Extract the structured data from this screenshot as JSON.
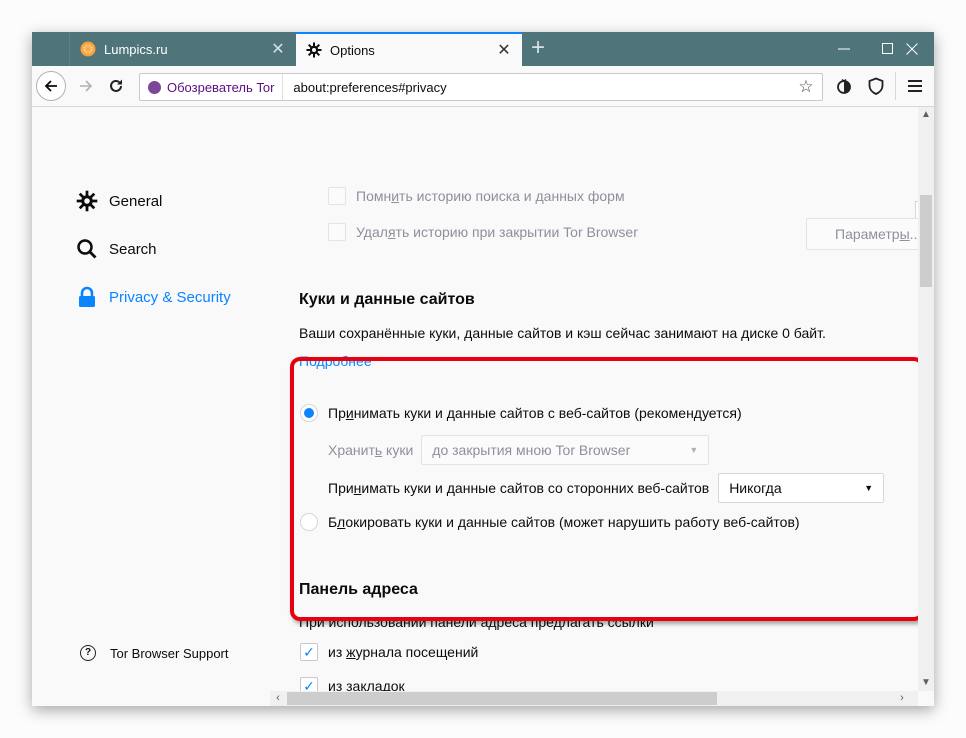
{
  "tabs": [
    {
      "label": "Lumpics.ru",
      "icon": "lumpics-favicon",
      "active": false
    },
    {
      "label": "Options",
      "icon": "gear-icon",
      "active": true
    }
  ],
  "window_controls": {
    "minimize": "—",
    "maximize": "☐",
    "close": "✕"
  },
  "navbar": {
    "identity_label": "Обозреватель Tor",
    "url": "about:preferences#privacy"
  },
  "sidebar": {
    "items": [
      {
        "label": "General",
        "icon": "gear-icon",
        "active": false
      },
      {
        "label": "Search",
        "icon": "search-icon",
        "active": false
      },
      {
        "label": "Privacy & Security",
        "icon": "lock-icon",
        "active": true
      }
    ],
    "support_label": "Tor Browser Support"
  },
  "history": {
    "remember_search": {
      "pre": "Помн",
      "u": "и",
      "post": "ть историю поиска и данных форм",
      "checked": false
    },
    "clear_on_close": {
      "pre": "Удал",
      "u": "я",
      "post": "ть историю при закрытии Tor Browser",
      "checked": false
    },
    "params_button": {
      "pre": "Параметр",
      "u": "ы",
      "post": "..."
    }
  },
  "cookies": {
    "title": "Куки и данные сайтов",
    "usage_text": "Ваши сохранённые куки, данные сайтов и кэш сейчас занимают на диске 0 байт.",
    "learn_more": "Подробнее",
    "accept_radio": {
      "pre": "Пр",
      "u": "и",
      "post": "нимать куки и данные сайтов с веб-сайтов (рекомендуется)",
      "selected": true
    },
    "keep_label": {
      "pre": "Хранит",
      "u": "ь",
      "post": " куки"
    },
    "keep_select_value": "до закрытия мною Tor Browser",
    "third_party_label": {
      "pre": "При",
      "u": "н",
      "post": "имать куки и данные сайтов со сторонних веб-сайтов"
    },
    "third_party_select_value": "Никогда",
    "block_radio": {
      "pre": "Б",
      "u": "л",
      "post": "окировать куки и данные сайтов (может нарушить работу веб-сайтов)",
      "selected": false
    }
  },
  "address_bar": {
    "title": "Панель адреса",
    "description": "При использовании панели адреса предлагать ссылки",
    "history_check": {
      "pre": "из ",
      "u": "ж",
      "post": "урнала посещений",
      "checked": true
    },
    "bookmarks_check": {
      "label": "из закладок",
      "checked": true
    }
  },
  "colors": {
    "accent": "#0a84ff",
    "tabbar": "#4f7479",
    "highlight": "#e8000f",
    "tor_purple": "#5c0f83"
  }
}
